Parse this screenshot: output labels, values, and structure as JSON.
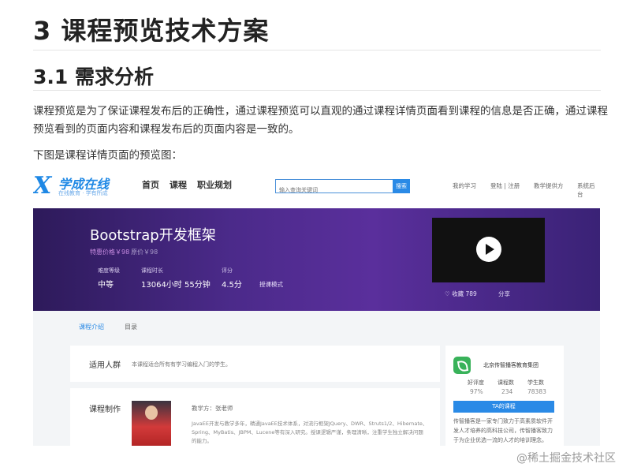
{
  "heading1": "3 课程预览技术方案",
  "heading2": "3.1 需求分析",
  "paragraph1": "课程预览是为了保证课程发布后的正确性，通过课程预览可以直观的通过课程详情页面看到课程的信息是否正确，通过课程预览看到的页面内容和课程发布后的页面内容是一致的。",
  "paragraph2": "下图是课程详情页面的预览图：",
  "screenshot": {
    "logo_text": "学成在线",
    "logo_sub": "在线教育 · 学有所成",
    "nav": [
      "首页",
      "课程",
      "职业规划"
    ],
    "search_placeholder": "输入查询关键词",
    "search_button": "搜索",
    "right_links": [
      "我的学习",
      "登陆 | 注册",
      "教学提供方",
      "系统后台"
    ],
    "course_title": "Bootstrap开发框架",
    "price_special": "特惠价格￥98",
    "price_original": "原价￥98",
    "meta": [
      {
        "label": "难度等级",
        "value": "中等"
      },
      {
        "label": "课程时长",
        "value": "13064小时 55分钟"
      },
      {
        "label": "评分",
        "value": "4.5分"
      }
    ],
    "meta_button": "授课模式",
    "favorite": "♡ 收藏 789",
    "share": "分享",
    "tabs": [
      "课程介绍",
      "目录"
    ],
    "audience_title": "适用人群",
    "audience_desc": "本课程适合所有有学习编程入门的学生。",
    "production_title": "课程制作",
    "teacher": "教学方：张老师",
    "teacher_desc": "JavaEE开发与教学多年，精通JavaEE技术体系，对流行框架JQuery、DWR、Struts1/2、Hibernate、Spring、MyBatis、JBPM、Lucene等有深入研究。授课逻辑严谨，条理清晰，注重学生独立解决问题的能力。",
    "org_name": "北京传智播客教育集团",
    "stats": [
      {
        "label": "好评度",
        "value": "97%"
      },
      {
        "label": "课程数",
        "value": "234"
      },
      {
        "label": "学生数",
        "value": "78383"
      }
    ],
    "ta_button": "TA的课程",
    "org_desc": "传智播客是一家专门致力于高素质软件开发人才培养的高科技公司，传智播客致力于为企业优选一流的人才的培训理念。"
  },
  "watermark": "@稀土掘金技术社区"
}
